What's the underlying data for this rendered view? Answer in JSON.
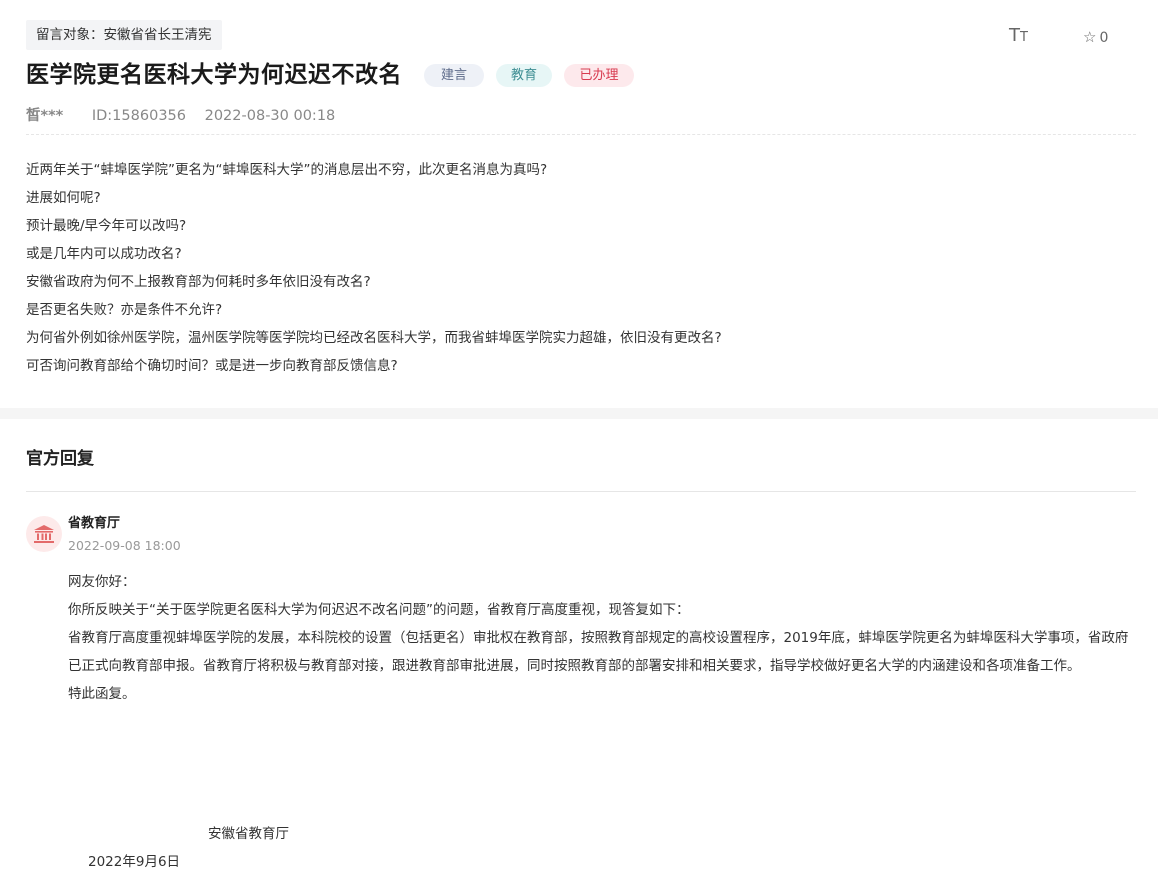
{
  "message": {
    "target_label": "留言对象：安徽省省长王清宪",
    "title": "医学院更名医科大学为何迟迟不改名",
    "tags": {
      "type": "建言",
      "category": "教育",
      "status": "已办理"
    },
    "user": "皙***",
    "id": "ID:15860356",
    "time": "2022-08-30 00:18",
    "font_toggle": {
      "big": "T",
      "small": "T"
    },
    "favorite_count": "0",
    "body": [
      "近两年关于“蚌埠医学院”更名为“蚌埠医科大学”的消息层出不穷，此次更名消息为真吗?",
      "进展如何呢?",
      "预计最晚/早今年可以改吗?",
      "或是几年内可以成功改名?",
      "安徽省政府为何不上报教育部为何耗时多年依旧没有改名?",
      "是否更名失败？亦是条件不允许?",
      "为何省外例如徐州医学院，温州医学院等医学院均已经改名医科大学，而我省蚌埠医学院实力超雄，依旧没有更改名?",
      "可否询问教育部给个确切时间？或是进一步向教育部反馈信息?"
    ]
  },
  "reply": {
    "section_title": "官方回复",
    "department": "省教育厅",
    "time": "2022-09-08 18:00",
    "paragraphs": [
      "网友你好：",
      "你所反映关于“关于医学院更名医科大学为何迟迟不改名问题”的问题，省教育厅高度重视，现答复如下：",
      "省教育厅高度重视蚌埠医学院的发展，本科院校的设置（包括更名）审批权在教育部，按照教育部规定的高校设置程序，2019年底，蚌埠医学院更名为蚌埠医科大学事项，省政府已正式向教育部申报。省教育厅将积极与教育部对接，跟进教育部审批进展，同时按照教育部的部署安排和相关要求，指导学校做好更名大学的内涵建设和各项准备工作。",
      "特此函复。"
    ],
    "signature_org": "安徽省教育厅",
    "signature_date": "2022年9月6日"
  },
  "icons": {
    "font_size": "font-size-icon",
    "favorite": "star-icon",
    "department": "government-building-icon"
  },
  "colors": {
    "tag_suggest": "#5d6b8a",
    "tag_edu": "#3e8e93",
    "tag_done": "#d83a4f",
    "avatar_icon": "#e36a6a"
  }
}
